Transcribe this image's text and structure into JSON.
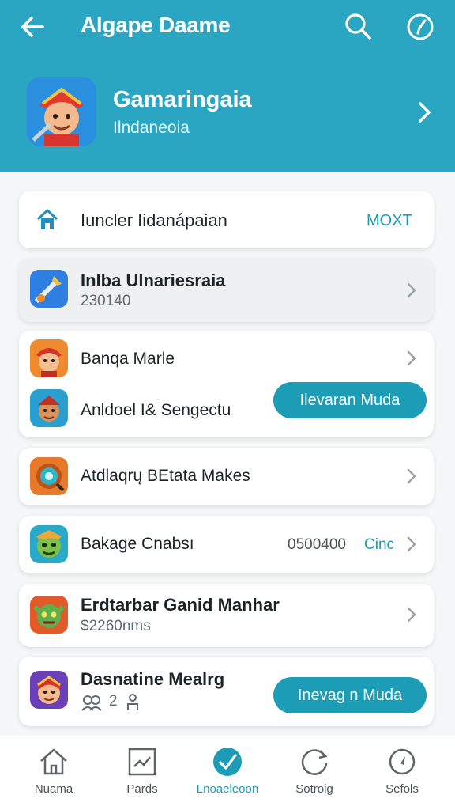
{
  "header": {
    "title": "Algape Daame",
    "back_icon": "arrow-left-icon",
    "search_icon": "search-icon",
    "compass_icon": "compass-icon"
  },
  "profile": {
    "name": "Gamaringaia",
    "subtitle": "Ilndaneoia",
    "avatar": "game-character-icon"
  },
  "banner": {
    "label": "Iuncler Iidanápaian",
    "action": "MOXT",
    "icon": "home-icon"
  },
  "items": [
    {
      "title": "Inlba Ulnariesraia",
      "subtitle": "230140",
      "icon": "sword-game-icon"
    },
    {
      "title": "Banqa Marle",
      "icon": "warrior-game-icon"
    },
    {
      "title": "Anldoel I& Sengectu",
      "button": "Ilevaran Muda",
      "icon": "pirate-game-icon"
    },
    {
      "title": "Atdlaqrų BEtata Makes",
      "icon": "target-game-icon"
    },
    {
      "title": "Bakage Cnabsı",
      "value": "0500400",
      "value_tag": "Cinc",
      "icon": "goblin-game-icon"
    },
    {
      "title": "Erdtarbar Ganid Manhar",
      "subtitle": "$2260nms",
      "icon": "monster-game-icon"
    },
    {
      "title": "Dasnatine Mealrg",
      "subtitle": "2",
      "button": "Inevag n Muda",
      "icon": "viking-game-icon"
    }
  ],
  "nav": [
    {
      "label": "Nuama",
      "icon": "house-icon"
    },
    {
      "label": "Pards",
      "icon": "chart-icon"
    },
    {
      "label": "Lnoaeleoon",
      "icon": "check-circle-icon",
      "active": true
    },
    {
      "label": "Sotroig",
      "icon": "refresh-icon"
    },
    {
      "label": "Sefols",
      "icon": "compass-icon"
    }
  ],
  "colors": {
    "primary": "#2aa6c2",
    "accent": "#1c9cb5",
    "background": "#f4f6f7"
  }
}
